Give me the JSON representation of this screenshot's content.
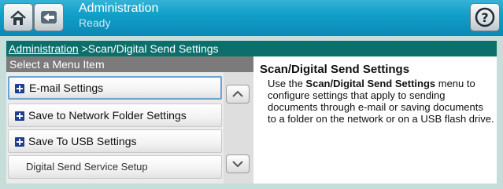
{
  "header": {
    "title": "Administration",
    "status": "Ready"
  },
  "breadcrumb": {
    "link": "Administration",
    "separator": " >",
    "current": "Scan/Digital Send Settings"
  },
  "menu": {
    "header": "Select a Menu Item",
    "items": [
      {
        "label": "E-mail Settings",
        "icon": "plus-icon",
        "selected": true
      },
      {
        "label": "Save to Network Folder Settings",
        "icon": "plus-icon",
        "selected": false
      },
      {
        "label": "Save To USB Settings",
        "icon": "plus-icon",
        "selected": false
      },
      {
        "label": "Digital Send Service Setup",
        "icon": null,
        "selected": false
      }
    ]
  },
  "help": {
    "title": "Scan/Digital Send Settings",
    "text_before": "Use the ",
    "text_bold": "Scan/Digital Send Settings",
    "text_after": " menu to configure settings that apply to sending documents through e-mail or saving documents to a folder on the network or on a USB flash drive."
  },
  "icons": {
    "home": "home-icon",
    "back": "back-arrow-icon",
    "help": "help-icon",
    "scroll_up": "chevron-up-icon",
    "scroll_down": "chevron-down-icon"
  },
  "colors": {
    "topbar": "#129fc9",
    "breadcrumb_bar": "#0c6f6b",
    "menu_header": "#7b7b7b",
    "selected_border": "#6aa3cc",
    "plus_icon": "#1c3f8f"
  }
}
